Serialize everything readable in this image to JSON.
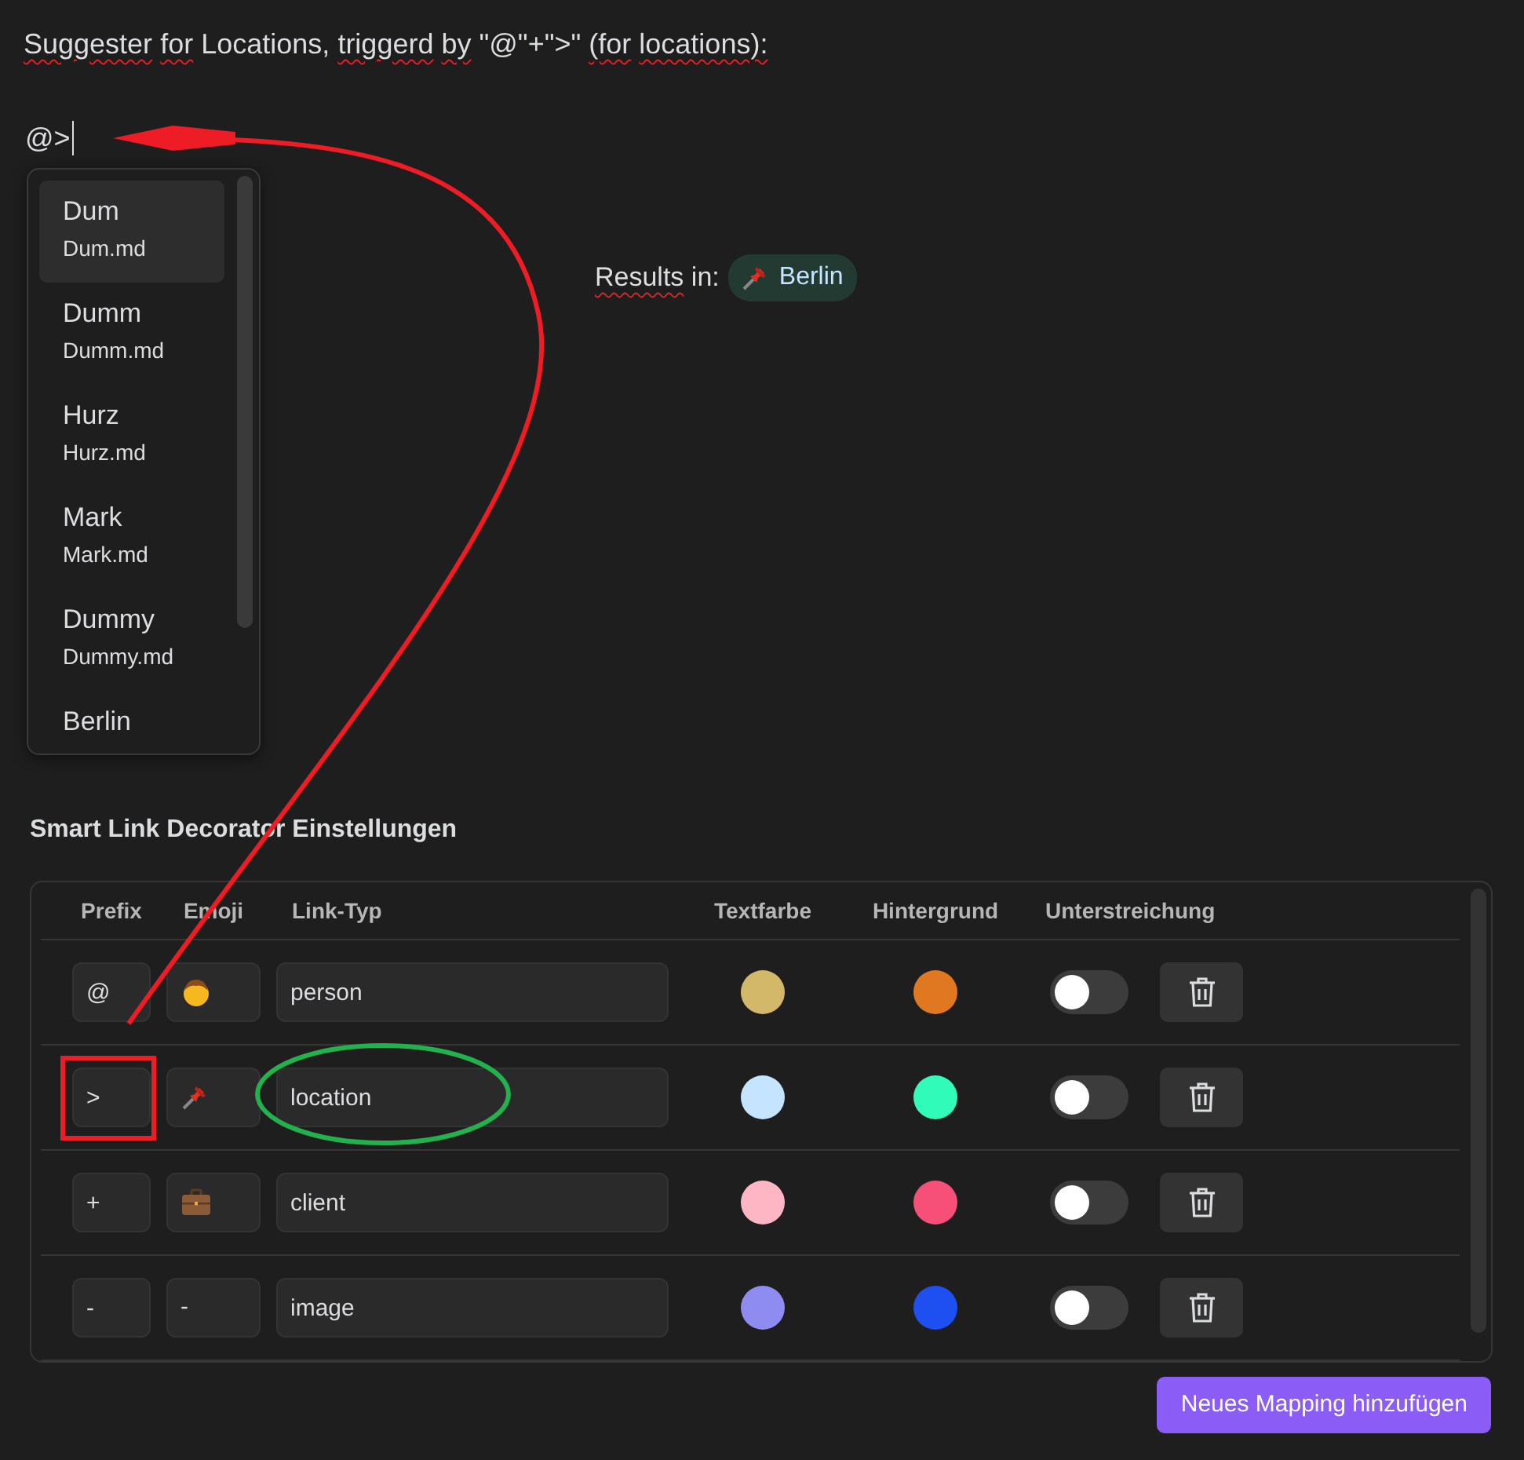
{
  "editor": {
    "heading": [
      {
        "text": "Suggester",
        "misspelled": true
      },
      {
        "text": "for",
        "misspelled": true
      },
      {
        "text": "Locations,",
        "misspelled": false
      },
      {
        "text": "triggerd",
        "misspelled": true
      },
      {
        "text": "by",
        "misspelled": true
      },
      {
        "text": "\"@\"+\">\"",
        "misspelled": false
      },
      {
        "text": "(for",
        "misspelled": true
      },
      {
        "text": "locations):",
        "misspelled": true
      }
    ],
    "typed": "@>",
    "result_label": [
      {
        "text": "Results",
        "misspelled": true
      },
      {
        "text": "in:",
        "misspelled": false
      }
    ],
    "result_chip": {
      "text": "Berlin"
    }
  },
  "suggestions": [
    {
      "title": "Dum",
      "file": "Dum.md",
      "selected": true
    },
    {
      "title": "Dumm",
      "file": "Dumm.md",
      "selected": false
    },
    {
      "title": "Hurz",
      "file": "Hurz.md",
      "selected": false
    },
    {
      "title": "Mark",
      "file": "Mark.md",
      "selected": false
    },
    {
      "title": "Dummy",
      "file": "Dummy.md",
      "selected": false
    },
    {
      "title": "Berlin",
      "selected": false
    }
  ],
  "settings": {
    "title": "Smart Link Decorator Einstellungen",
    "columns": [
      "Prefix",
      "Emoji",
      "Link-Typ",
      "Textfarbe",
      "Hintergrund",
      "Unterstreichung"
    ],
    "rows": [
      {
        "prefix": "@",
        "emoji": {
          "kind": "person"
        },
        "link_type": "person",
        "text_color": {
          "color": "#d4b86a"
        },
        "background": {
          "color": "#e07822"
        },
        "underline": false
      },
      {
        "prefix": ">",
        "emoji": {
          "kind": "pushpin"
        },
        "link_type": "location",
        "text_color": {
          "color": "#c4e4ff"
        },
        "background": {
          "color": "#31fbb8"
        },
        "underline": false
      },
      {
        "prefix": "+",
        "emoji": {
          "kind": "briefcase"
        },
        "link_type": "client",
        "text_color": {
          "color": "#ffb6c4"
        },
        "background": {
          "color": "#f64f78"
        },
        "underline": false
      },
      {
        "prefix": "-",
        "emoji": {
          "kind": "text",
          "text": "-"
        },
        "link_type": "image",
        "text_color": {
          "color": "#8e8cf0"
        },
        "background": {
          "color": "#1e4ff0"
        },
        "underline": false
      }
    ],
    "add_button": "Neues Mapping hinzufügen"
  },
  "annotations": [
    {
      "kind": "arrow",
      "color": "#ee1c25"
    },
    {
      "kind": "rectangle",
      "color": "#ee1c25"
    },
    {
      "kind": "ellipse",
      "color": "#22b14c"
    }
  ]
}
